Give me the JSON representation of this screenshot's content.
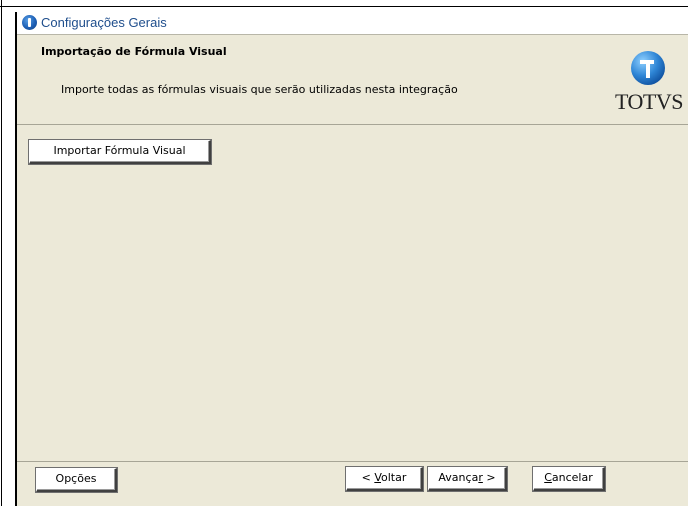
{
  "window": {
    "title": "Configurações Gerais",
    "icon": "app-globe-icon"
  },
  "header": {
    "title": "Importação de Fórmula Visual",
    "subtitle": "Importe todas as fórmulas visuais que serão utilizadas nesta integração",
    "logo_text": "TOTVS"
  },
  "content": {
    "import_button_label": "Importar Fórmula Visual"
  },
  "footer": {
    "options_label": "Opções",
    "back": {
      "prefix": "< ",
      "mnemonic": "V",
      "rest": "oltar"
    },
    "next": {
      "prefix": "Avança",
      "mnemonic": "r",
      "rest": " >"
    },
    "cancel": {
      "prefix": "",
      "mnemonic": "C",
      "rest": "ancelar"
    }
  },
  "colors": {
    "dialog_background": "#ece9d8",
    "title_text": "#1f4e8c",
    "logo_blue": "#2f86d6"
  }
}
